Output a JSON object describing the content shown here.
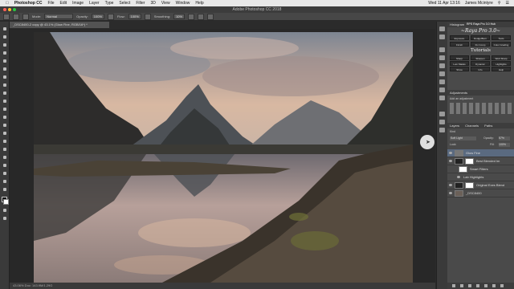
{
  "menubar": {
    "apple": "",
    "app": "Photoshop CC",
    "items": [
      "File",
      "Edit",
      "Image",
      "Layer",
      "Type",
      "Select",
      "Filter",
      "3D",
      "View",
      "Window",
      "Help"
    ],
    "clock": "Wed 11 Apr  13:16",
    "user": "James Mcintyre"
  },
  "titlebar": {
    "title": "Adobe Photoshop CC 2018"
  },
  "options": {
    "mode_label": "Mode:",
    "mode_value": "Normal",
    "opacity_label": "Opacity:",
    "opacity_value": "100%",
    "flow_label": "Flow:",
    "flow_value": "100%",
    "smoothing_label": "Smoothing:",
    "smoothing_value": "10%"
  },
  "document": {
    "tab": "_DSC8400-2 copy @ 43.1% (Glow Fine, RGB/16*) *",
    "status": "43.06%   Doc: 143.9M/1.29G"
  },
  "panels": {
    "histogram_tab": "Histogram",
    "raya_tab": "RPS Raya Pro 3.0 Hub",
    "raya_title": "~Raya Pro 3.0~",
    "raya_buttons": [
      "Exposure",
      "Dodge/Burn",
      "Tools"
    ],
    "raya_buttons2": [
      "Finish",
      "Fix Comp",
      "Color Grading"
    ],
    "tutorials": "Tutorials",
    "raya_row3": [
      "Sharp",
      "Sharpen",
      "Web Sharp"
    ],
    "raya_row4": [
      "Lum Masks",
      "Dynamic",
      "Highlights"
    ],
    "raya_row5": [
      "Show",
      "Info",
      "Help"
    ],
    "adjustments_tab": "Adjustments",
    "adjustments_hint": "Add an adjustment",
    "layers_tabs": [
      "Layers",
      "Channels",
      "Paths"
    ],
    "kind_label": "Kind",
    "blend_mode": "Soft Light",
    "opacity_label": "Opacity:",
    "opacity_value": "57%",
    "fill_label": "Fill:",
    "fill_value": "100%",
    "lock_label": "Lock:",
    "layers": [
      "Glow Fine",
      "Best Blended Im",
      "Smart Filters",
      "Lab Highlights",
      "Original Exes Blend",
      "_DSC8400"
    ]
  },
  "colors": {
    "menubar_bg": "#e8e8e8",
    "ui_dark": "#3a3a3a",
    "panel_bg": "#4a4a4a",
    "selected_layer": "#5a6a80"
  }
}
